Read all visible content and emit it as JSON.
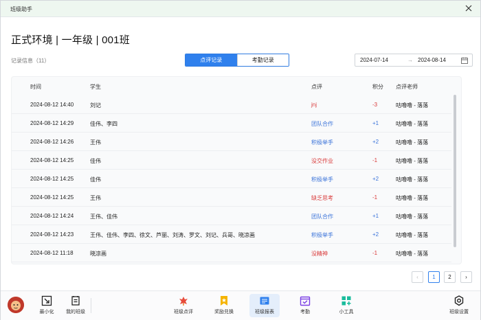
{
  "window": {
    "title": "班级助手"
  },
  "header": {
    "title": "正式环境 | 一年级 | 001班",
    "record_info": "记录信息（11）"
  },
  "tabs": [
    {
      "label": "点评记录",
      "active": true
    },
    {
      "label": "考勤记录",
      "active": false
    }
  ],
  "date_range": {
    "start": "2024-07-14",
    "separator": "→",
    "end": "2024-08-14"
  },
  "table": {
    "columns": [
      "时间",
      "学生",
      "点评",
      "积分",
      "点评老师"
    ],
    "rows": [
      {
        "time": "2024-08-12 14:40",
        "student": "刘记",
        "comment": "jnj",
        "comment_color": "red",
        "score": "-3",
        "score_color": "red",
        "teacher": "咕噜噜 - 落落"
      },
      {
        "time": "2024-08-12 14:29",
        "student": "佳伟、李四",
        "comment": "团队合作",
        "comment_color": "blue",
        "score": "+1",
        "score_color": "blue",
        "teacher": "咕噜噜 - 落落"
      },
      {
        "time": "2024-08-12 14:26",
        "student": "王伟",
        "comment": "积极举手",
        "comment_color": "blue",
        "score": "+2",
        "score_color": "blue",
        "teacher": "咕噜噜 - 落落"
      },
      {
        "time": "2024-08-12 14:25",
        "student": "佳伟",
        "comment": "没交作业",
        "comment_color": "red",
        "score": "-1",
        "score_color": "red",
        "teacher": "咕噜噜 - 落落"
      },
      {
        "time": "2024-08-12 14:25",
        "student": "佳伟",
        "comment": "积极举手",
        "comment_color": "blue",
        "score": "+2",
        "score_color": "blue",
        "teacher": "咕噜噜 - 落落"
      },
      {
        "time": "2024-08-12 14:25",
        "student": "王伟",
        "comment": "缺乏思考",
        "comment_color": "red",
        "score": "-1",
        "score_color": "red",
        "teacher": "咕噜噜 - 落落"
      },
      {
        "time": "2024-08-12 14:24",
        "student": "王伟、佳伟",
        "comment": "团队合作",
        "comment_color": "blue",
        "score": "+1",
        "score_color": "blue",
        "teacher": "咕噜噜 - 落落"
      },
      {
        "time": "2024-08-12 14:23",
        "student": "王伟、佳伟、李四、徐文、芦丽、刘涛、罗文、刘记、兵哥、晓凉画",
        "comment": "积极举手",
        "comment_color": "blue",
        "score": "+2",
        "score_color": "blue",
        "teacher": "咕噜噜 - 落落"
      },
      {
        "time": "2024-08-12 11:18",
        "student": "晓凉画",
        "comment": "没精神",
        "comment_color": "red",
        "score": "-1",
        "score_color": "red",
        "teacher": "咕噜噜 - 落落"
      }
    ]
  },
  "pagination": {
    "prev": "‹",
    "pages": [
      "1",
      "2"
    ],
    "current": "1",
    "next": "›"
  },
  "toolbar": {
    "minimize": "最小化",
    "my_class": "我的班级",
    "class_review": "班级点评",
    "rewards": "奖励兑换",
    "class_report": "班级报表",
    "attendance": "考勤",
    "tools": "小工具",
    "settings": "班级设置"
  },
  "colors": {
    "accent": "#2f80ed",
    "negative": "#d93a3a",
    "positive": "#3a73d9"
  }
}
